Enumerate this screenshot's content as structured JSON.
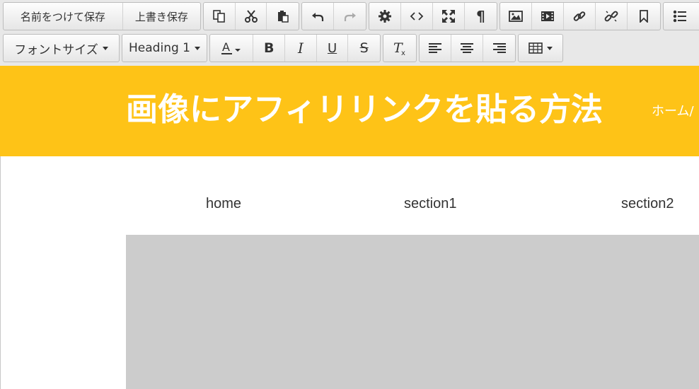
{
  "toolbar": {
    "save_as_label": "名前をつけて保存",
    "overwrite_label": "上書き保存",
    "font_size_label": "フォントサイズ",
    "format_label": "Heading 1"
  },
  "icons": {
    "copy": "copy-icon",
    "cut": "cut-icon",
    "paste": "paste-icon",
    "undo": "undo-icon",
    "redo": "redo-icon",
    "settings": "gear-icon",
    "source": "code-icon",
    "fullscreen": "fullscreen-icon",
    "pilcrow": "pilcrow-icon",
    "image": "image-icon",
    "media": "film-icon",
    "link": "link-icon",
    "unlink": "unlink-icon",
    "bookmark": "bookmark-icon",
    "list": "bullet-list-icon",
    "text_color": "text-color-icon",
    "bold": "bold-icon",
    "italic": "italic-icon",
    "underline": "underline-icon",
    "strike": "strikethrough-icon",
    "clear": "clear-format-icon",
    "align_left": "align-left-icon",
    "align_center": "align-center-icon",
    "align_right": "align-right-icon",
    "table": "table-icon"
  },
  "colors": {
    "banner": "#fec317",
    "hero": "#cccccc",
    "toolbar": "#e8e8e8"
  },
  "page": {
    "site_title": "画像にアフィリリンクを貼る方法",
    "banner_link": "ホーム/",
    "nav": [
      "home",
      "section1",
      "section2"
    ]
  }
}
